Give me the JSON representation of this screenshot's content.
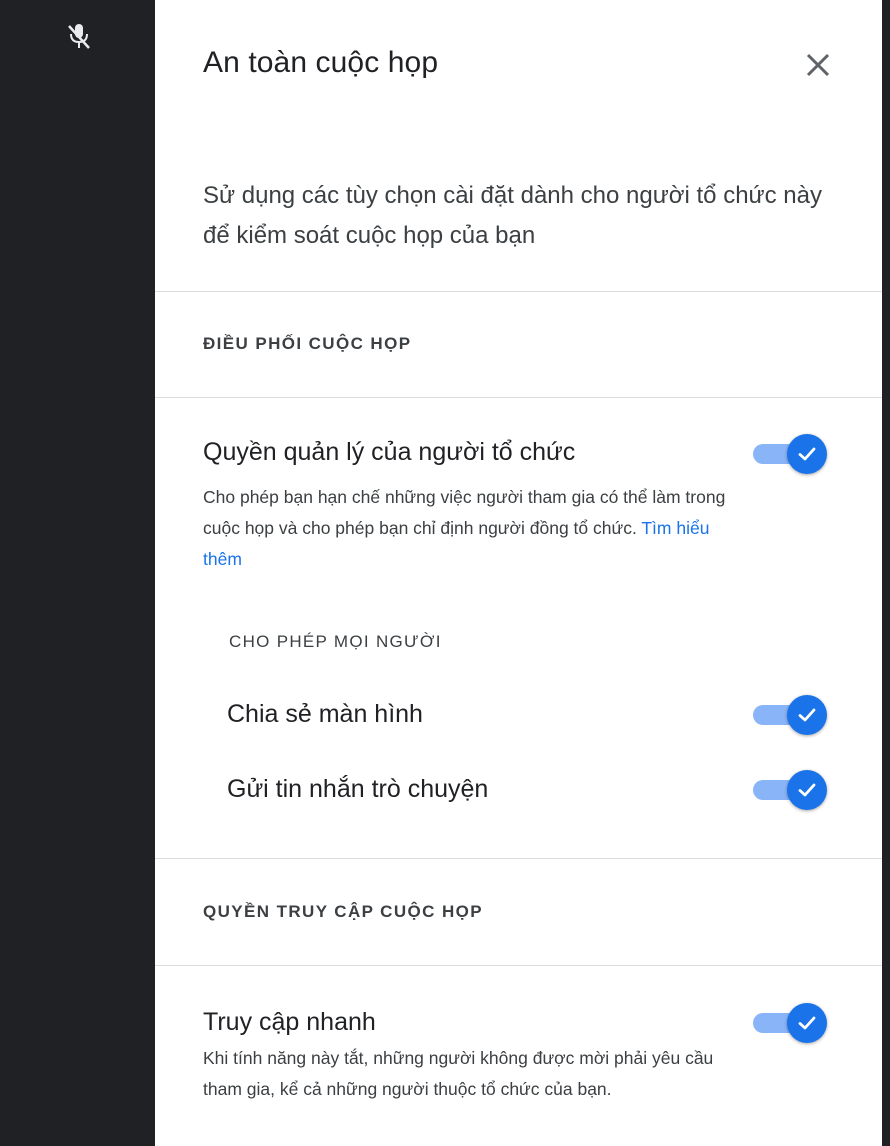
{
  "panel": {
    "title": "An toàn cuộc họp",
    "description": "Sử dụng các tùy chọn cài đặt dành cho người tổ chức này để kiểm soát cuộc họp của bạn"
  },
  "sections": [
    {
      "header": "ĐIỀU PHỐI CUỘC HỌP",
      "settings": [
        {
          "title": "Quyền quản lý của người tổ chức",
          "description": "Cho phép bạn hạn chế những việc người tham gia có thể làm trong cuộc họp và cho phép bạn chỉ định người đồng tổ chức.",
          "link": "Tìm hiểu thêm",
          "enabled": true
        }
      ],
      "subheader": "CHO PHÉP MỌI NGƯỜI",
      "subsettings": [
        {
          "title": "Chia sẻ màn hình",
          "enabled": true
        },
        {
          "title": "Gửi tin nhắn trò chuyện",
          "enabled": true
        }
      ]
    },
    {
      "header": "QUYỀN TRUY CẬP CUỘC HỌP",
      "settings": [
        {
          "title": "Truy cập nhanh",
          "description": "Khi tính năng này tắt, những người không được mời phải yêu cầu tham gia, kể cả những người thuộc tổ chức của bạn.",
          "enabled": true
        }
      ]
    }
  ],
  "colors": {
    "accent": "#1a73e8",
    "toggle_track": "#8ab4f8",
    "sidebar_bg": "#202124",
    "divider": "#dadce0"
  },
  "icons": {
    "mic": "mic-off-icon",
    "close": "close-icon",
    "toggle_check": "check-icon"
  }
}
